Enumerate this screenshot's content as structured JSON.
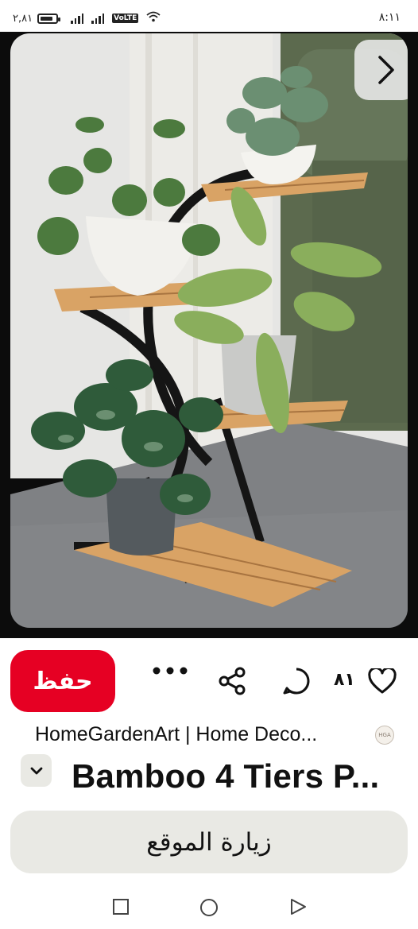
{
  "status_bar": {
    "speed": "٢,٨١",
    "battery_level": 0.85,
    "volte": "VoLTE",
    "time": "٨:١١"
  },
  "pin": {
    "save_label": "حفظ",
    "like_count": "٨١",
    "source": "HomeGardenArt | Home Deco...",
    "avatar_text": "HGA",
    "title": "Bamboo 4 Tiers P...",
    "visit_label": "زيارة الموقع"
  },
  "icons": {
    "next": "chevron-right-icon",
    "more": "more-icon",
    "share": "share-icon",
    "comment": "comment-icon",
    "like": "heart-icon",
    "expand": "chevron-down-icon",
    "recents": "square-icon",
    "home": "circle-icon",
    "back": "triangle-back-icon"
  },
  "colors": {
    "save_button": "#e60023",
    "secondary_button": "#e9e9e4",
    "text": "#111111"
  }
}
